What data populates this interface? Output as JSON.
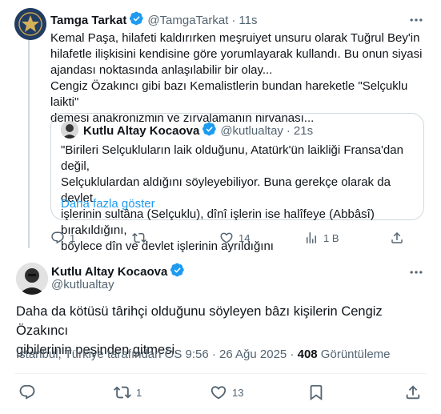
{
  "tweet1": {
    "author_name": "Tamga Tarkat",
    "handle": "@TamgaTarkat",
    "separator": "·",
    "time": "11s",
    "text": "Kemal Paşa,  hilafeti kaldırırken meşruiyet unsuru olarak Tuğrul Bey'in\nhilafetle ilişkisini kendisine göre yorumlayarak kullandı. Bu onun siyasi\najandası noktasında anlaşılabilir bir olay...\nCengiz Özakıncı gibi bazı Kemalistlerin bundan hareketle \"Selçuklu laikti\"\ndemesi anakronizmin ve zırvalamanın nirvanası...",
    "quote": {
      "author_name": "Kutlu Altay Kocaova",
      "handle": "@kutlualtay",
      "separator": "·",
      "time": "21s",
      "text": "\"Birileri Selçukluların laik olduğunu, Atatürk'ün laikliği Fransa'dan değil,\nSelçuklulardan aldığını söyleyebiliyor. Buna gerekçe olarak da devlet\nişlerinin sultâna (Selçuklu), dînî işlerin ise halîfeye (Abbâsî) bırakıldığını,\nböylece dîn ve devlet işlerinin ayrıldığını",
      "show_more": "Daha fazla göster"
    },
    "actions": {
      "replies": "1",
      "reposts": "",
      "likes": "14",
      "views": "1 B"
    }
  },
  "tweet2": {
    "author_name": "Kutlu Altay Kocaova",
    "handle": "@kutlualtay",
    "text": "Daha da kötüsü târihçi olduğunu söyleyen bâzı kişilerin Cengiz Özakıncı\ngibilerinin peşinden gitmesi.",
    "meta_location_time": "İstanbul, Türkiye tarafından ÖS 9:56 · 26 Ağu 2025 · ",
    "meta_views": "408",
    "meta_views_label": " Görüntüleme",
    "actions": {
      "replies": "",
      "reposts": "1",
      "likes": "13"
    }
  },
  "colors": {
    "accent": "#1d9bf0",
    "text": "#0f1419",
    "muted": "#536471",
    "border": "#cfd9de"
  },
  "icons": [
    "verified-badge-icon",
    "more-icon",
    "reply-icon",
    "repost-icon",
    "like-icon",
    "views-icon",
    "bookmark-icon",
    "share-icon"
  ]
}
